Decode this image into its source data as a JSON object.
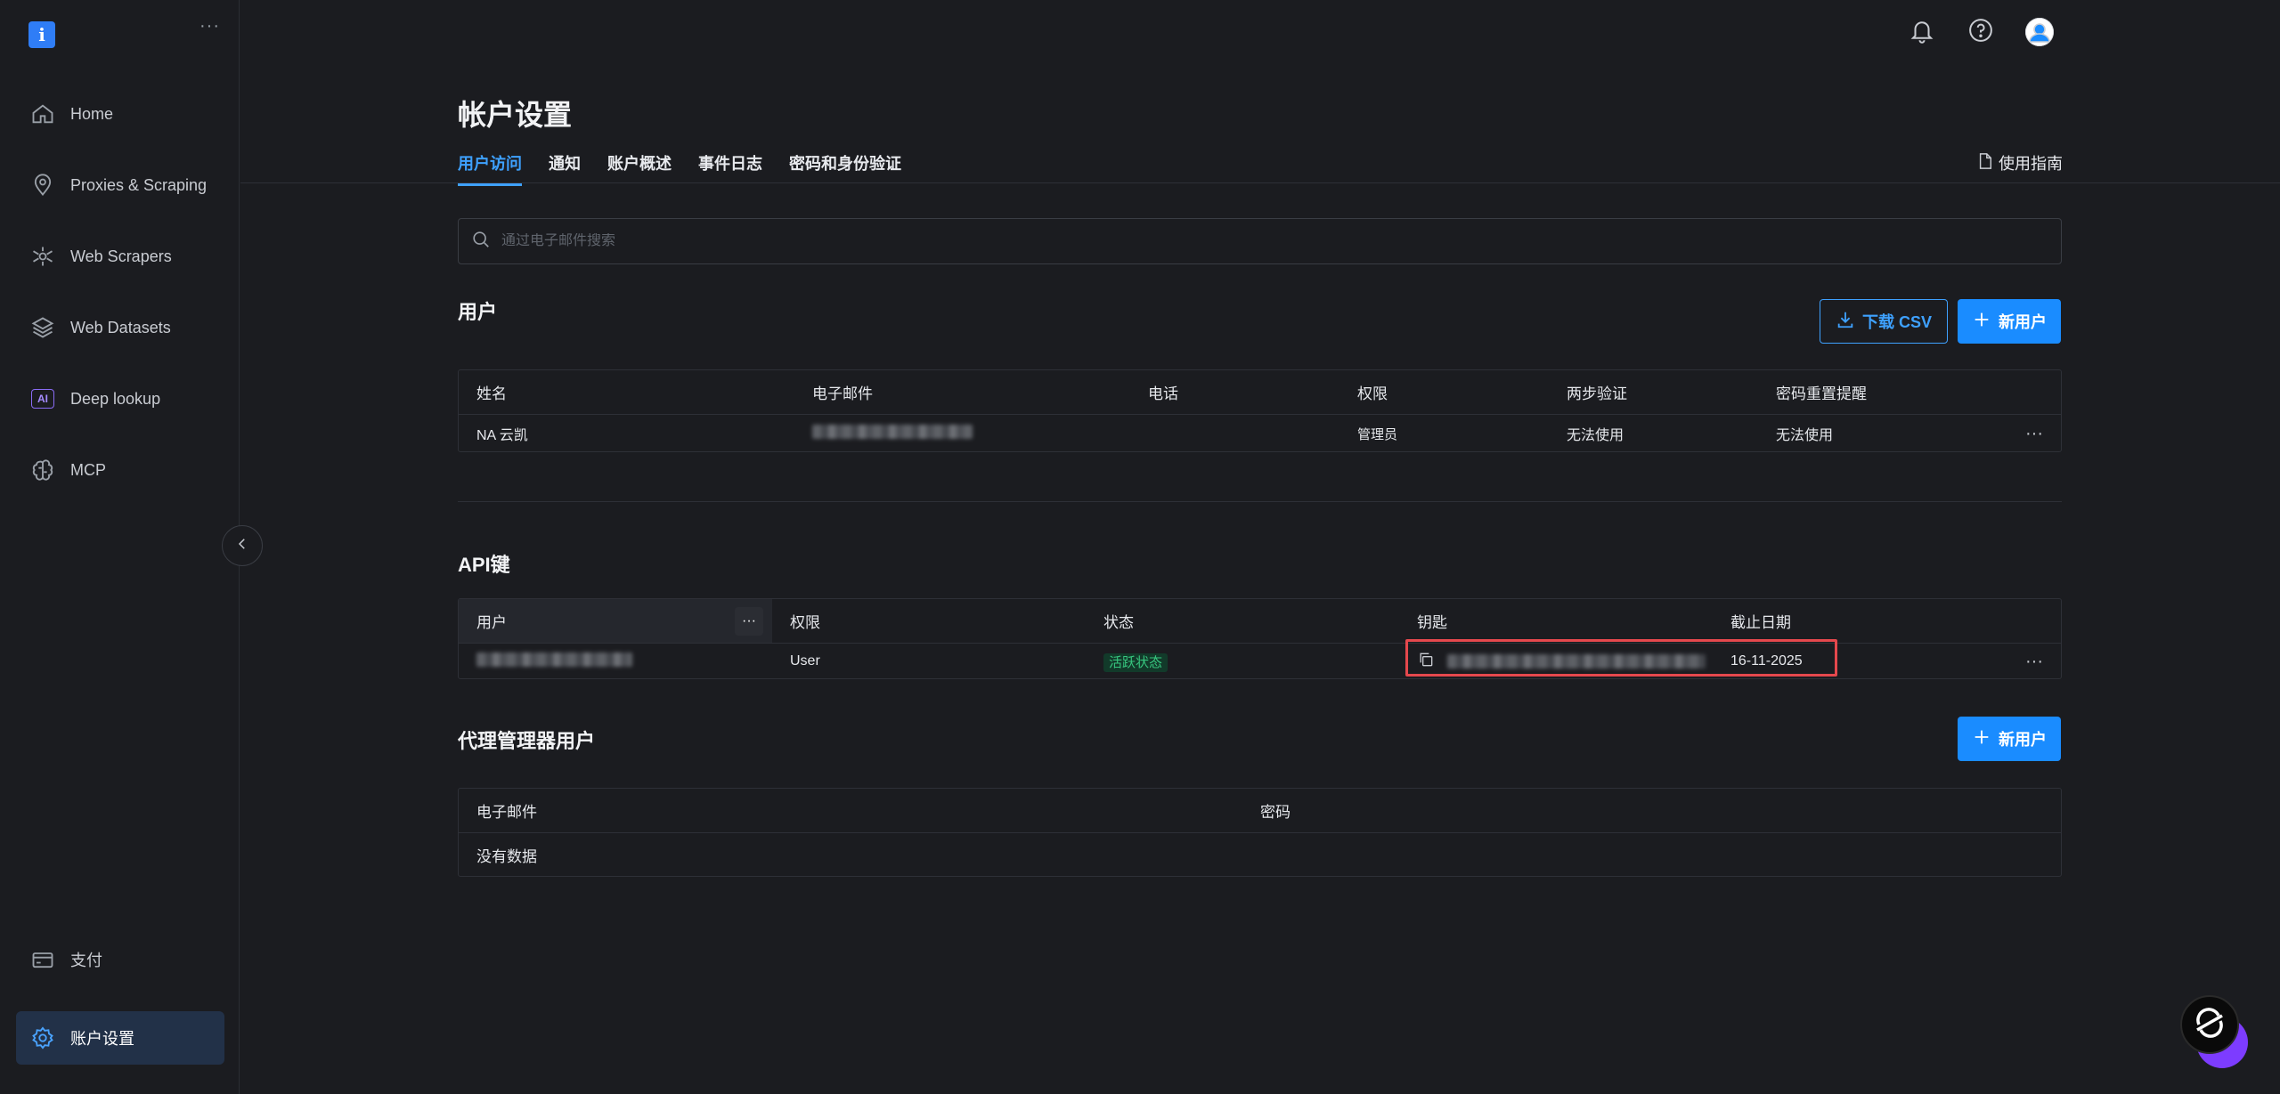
{
  "sidebar": {
    "logo": "i",
    "items": [
      {
        "label": "Home",
        "icon": "home-icon"
      },
      {
        "label": "Proxies & Scraping",
        "icon": "location-pin-icon"
      },
      {
        "label": "Web Scrapers",
        "icon": "scraper-icon"
      },
      {
        "label": "Web Datasets",
        "icon": "layers-icon"
      },
      {
        "label": "Deep lookup",
        "icon": "ai-icon",
        "badge": "AI"
      },
      {
        "label": "MCP",
        "icon": "brain-icon"
      }
    ],
    "bottom": [
      {
        "label": "支付",
        "icon": "card-icon"
      },
      {
        "label": "账户设置",
        "icon": "gear-icon",
        "active": true
      }
    ]
  },
  "header": {
    "title": "帐户设置",
    "tabs": [
      {
        "label": "用户访问",
        "active": true
      },
      {
        "label": "通知"
      },
      {
        "label": "账户概述"
      },
      {
        "label": "事件日志"
      },
      {
        "label": "密码和身份验证"
      }
    ],
    "guide_label": "使用指南"
  },
  "search": {
    "placeholder": "通过电子邮件搜索",
    "value": ""
  },
  "users": {
    "title": "用户",
    "download_label": "下载 CSV",
    "new_label": "新用户",
    "columns": [
      "姓名",
      "电子邮件",
      "电话",
      "权限",
      "两步验证",
      "密码重置提醒"
    ],
    "rows": [
      {
        "name": "NA 云凯",
        "email": "",
        "phone": "",
        "role": "管理员",
        "two_factor": "无法使用",
        "reset_reminder": "无法使用"
      }
    ]
  },
  "api_keys": {
    "title": "API键",
    "columns": [
      "用户",
      "权限",
      "状态",
      "钥匙",
      "截止日期"
    ],
    "rows": [
      {
        "user": "",
        "role": "User",
        "status": "活跃状态",
        "key": "",
        "expiry": "16-11-2025"
      }
    ]
  },
  "proxy_users": {
    "title": "代理管理器用户",
    "new_label": "新用户",
    "columns": [
      "电子邮件",
      "密码"
    ],
    "empty": "没有数据"
  },
  "colors": {
    "accent": "#1a8cff",
    "highlight": "#e5484d",
    "active_badge": "#37c77f"
  }
}
